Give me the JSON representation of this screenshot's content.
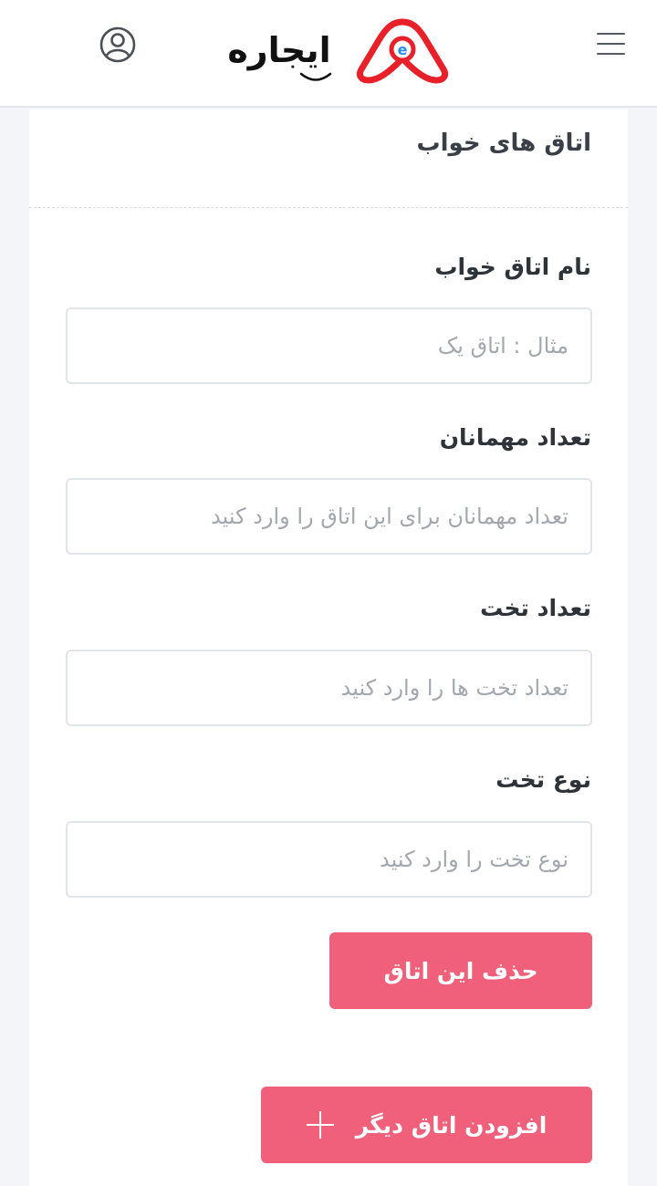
{
  "header": {
    "brand": "ایجاره",
    "menu_icon": "hamburger-menu-icon",
    "user_icon": "user-profile-icon",
    "brand_color": "#e8202a"
  },
  "section": {
    "title": "اتاق های خواب"
  },
  "fields": [
    {
      "label": "نام اتاق خواب",
      "placeholder": "مثال : اتاق یک",
      "value": ""
    },
    {
      "label": "تعداد مهمانان",
      "placeholder": "تعداد مهمانان برای این اتاق را وارد کنید",
      "value": ""
    },
    {
      "label": "تعداد تخت",
      "placeholder": "تعداد تخت ها را وارد کنید",
      "value": ""
    },
    {
      "label": "نوع تخت",
      "placeholder": "نوع تخت را وارد کنید",
      "value": ""
    }
  ],
  "actions": {
    "delete_room": "حذف این اتاق",
    "add_room": "افزودن اتاق دیگر",
    "add_icon": "plus-icon",
    "button_color": "#f1607a"
  }
}
